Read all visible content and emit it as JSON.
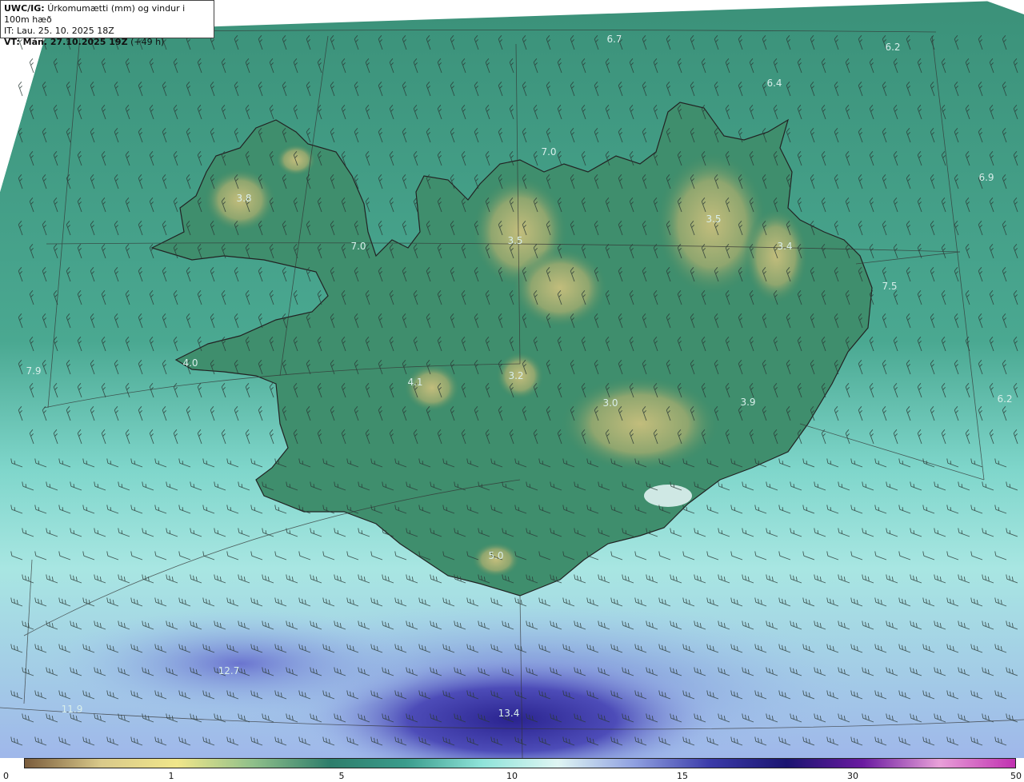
{
  "header": {
    "model": "UWC/IG:",
    "title": "Úrkomumætti (mm) og vindur i 100m hæð",
    "issue_time": "IT: Lau. 25. 10. 2025 18Z",
    "valid_label": "VT: Mán. 27.10.2025 19Z",
    "valid_offset": "(+49 h)"
  },
  "map_labels": [
    {
      "text": "6.7"
    },
    {
      "text": "6.2"
    },
    {
      "text": "6.4"
    },
    {
      "text": "7.0"
    },
    {
      "text": "6.9"
    },
    {
      "text": "3.8"
    },
    {
      "text": "7.0"
    },
    {
      "text": "3.5"
    },
    {
      "text": "3.5"
    },
    {
      "text": "3.4"
    },
    {
      "text": "7.5"
    },
    {
      "text": "4.0"
    },
    {
      "text": "7.9"
    },
    {
      "text": "4.1"
    },
    {
      "text": "3.2"
    },
    {
      "text": "3.0"
    },
    {
      "text": "3.9"
    },
    {
      "text": "6.2"
    },
    {
      "text": "5.0"
    },
    {
      "text": "12.7"
    },
    {
      "text": "11.9"
    },
    {
      "text": "13.4"
    }
  ],
  "colorbar": {
    "labels": [
      "0",
      "1",
      "5",
      "10",
      "15",
      "30",
      "50"
    ],
    "stops": [
      "#7a5c3c",
      "#d9c98a",
      "#f0e68a",
      "#8fbf8a",
      "#2e7d6b",
      "#3a9c8c",
      "#8fe3d9",
      "#dff5f3",
      "#8fa0e0",
      "#3a3aa8",
      "#1a1470",
      "#6a1aa0",
      "#e8a0d8",
      "#c030b0"
    ]
  },
  "colors": {
    "land_low": "#2e8a68",
    "land_high": "#b5b777",
    "ocean_north": "#3c9b84",
    "ocean_south": "#9fe6e0",
    "heavy_precip": "#3f3bb0",
    "coastline": "#222222",
    "barb": "#333333"
  }
}
